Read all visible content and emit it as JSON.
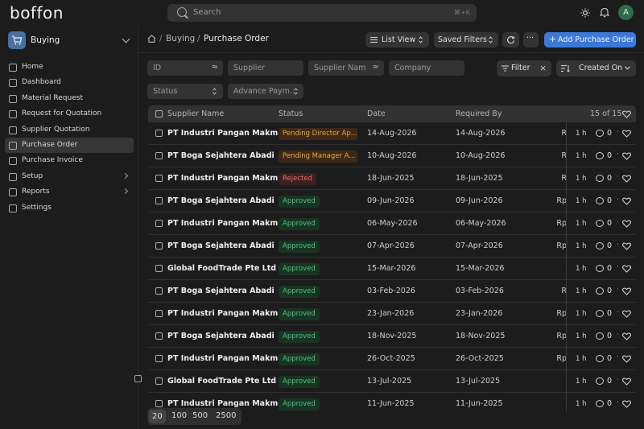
{
  "app": {
    "logo": "boffon",
    "module": "Buying"
  },
  "search": {
    "placeholder": "Search",
    "shortcut": "⌘+K"
  },
  "user": {
    "avatar_initial": "A"
  },
  "sidebar": {
    "items": [
      {
        "label": "Home",
        "icon": "home-icon"
      },
      {
        "label": "Dashboard",
        "icon": "dashboard-icon"
      },
      {
        "label": "Material Request",
        "icon": "document-icon"
      },
      {
        "label": "Request for Quotation",
        "icon": "document-icon"
      },
      {
        "label": "Supplier Quotation",
        "icon": "document-icon"
      },
      {
        "label": "Purchase Order",
        "icon": "document-icon",
        "active": true
      },
      {
        "label": "Purchase Invoice",
        "icon": "document-icon"
      },
      {
        "label": "Setup",
        "icon": "gear-icon",
        "expandable": true
      },
      {
        "label": "Reports",
        "icon": "grid-icon",
        "expandable": true
      },
      {
        "label": "Settings",
        "icon": "gear-icon"
      }
    ]
  },
  "header": {
    "breadcrumb": [
      "Buying",
      "Purchase Order"
    ],
    "list_view_label": "List View",
    "saved_filters_label": "Saved Filters",
    "add_label": "Add Purchase Order",
    "more_label": "···"
  },
  "filters": {
    "id_placeholder": "ID",
    "id_operator": "≈",
    "supplier_placeholder": "Supplier",
    "supplier_name_placeholder": "Supplier Nam",
    "supplier_name_operator": "≈",
    "company_placeholder": "Company",
    "status_placeholder": "Status",
    "advance_payment_placeholder": "Advance Paym...",
    "filter_label": "Filter",
    "sort_label": "Created On"
  },
  "table": {
    "columns": [
      "Supplier Name",
      "Status",
      "Date",
      "Required By"
    ],
    "count": "15 of 15",
    "rows": [
      {
        "supplier": "PT Industri Pangan Makmur",
        "status": "Pending Director Ap...",
        "status_type": "pending",
        "date": "14-Aug-2026",
        "required_by": "14-Aug-2026",
        "amount": "R",
        "modified": "1 h",
        "comments": "0"
      },
      {
        "supplier": "PT Boga Sejahtera Abadi",
        "status": "Pending Manager A...",
        "status_type": "pending",
        "date": "10-Aug-2026",
        "required_by": "10-Aug-2026",
        "amount": "R",
        "modified": "1 h",
        "comments": "0"
      },
      {
        "supplier": "PT Industri Pangan Makmur",
        "status": "Rejected",
        "status_type": "rejected",
        "date": "18-Jun-2025",
        "required_by": "18-Jun-2025",
        "amount": "R",
        "modified": "1 h",
        "comments": "0"
      },
      {
        "supplier": "PT Boga Sejahtera Abadi",
        "status": "Approved",
        "status_type": "approved",
        "date": "09-Jun-2026",
        "required_by": "09-Jun-2026",
        "amount": "Rp",
        "modified": "1 h",
        "comments": "0"
      },
      {
        "supplier": "PT Industri Pangan Makmur",
        "status": "Approved",
        "status_type": "approved",
        "date": "06-May-2026",
        "required_by": "06-May-2026",
        "amount": "Rp",
        "modified": "1 h",
        "comments": "0"
      },
      {
        "supplier": "PT Boga Sejahtera Abadi",
        "status": "Approved",
        "status_type": "approved",
        "date": "07-Apr-2026",
        "required_by": "07-Apr-2026",
        "amount": "Rp",
        "modified": "1 h",
        "comments": "0"
      },
      {
        "supplier": "Global FoodTrade Pte Ltd",
        "status": "Approved",
        "status_type": "approved",
        "date": "15-Mar-2026",
        "required_by": "15-Mar-2026",
        "amount": "",
        "modified": "1 h",
        "comments": "0"
      },
      {
        "supplier": "PT Boga Sejahtera Abadi",
        "status": "Approved",
        "status_type": "approved",
        "date": "03-Feb-2026",
        "required_by": "03-Feb-2026",
        "amount": "R",
        "modified": "1 h",
        "comments": "0"
      },
      {
        "supplier": "PT Industri Pangan Makmur",
        "status": "Approved",
        "status_type": "approved",
        "date": "23-Jan-2026",
        "required_by": "23-Jan-2026",
        "amount": "Rp",
        "modified": "1 h",
        "comments": "0"
      },
      {
        "supplier": "PT Boga Sejahtera Abadi",
        "status": "Approved",
        "status_type": "approved",
        "date": "18-Nov-2025",
        "required_by": "18-Nov-2025",
        "amount": "Rp",
        "modified": "1 h",
        "comments": "0"
      },
      {
        "supplier": "PT Industri Pangan Makmur",
        "status": "Approved",
        "status_type": "approved",
        "date": "26-Oct-2025",
        "required_by": "26-Oct-2025",
        "amount": "Rp",
        "modified": "1 h",
        "comments": "0"
      },
      {
        "supplier": "Global FoodTrade Pte Ltd",
        "status": "Approved",
        "status_type": "approved",
        "date": "13-Jul-2025",
        "required_by": "13-Jul-2025",
        "amount": "",
        "modified": "1 h",
        "comments": "0"
      },
      {
        "supplier": "PT Industri Pangan Makmur",
        "status": "Approved",
        "status_type": "approved",
        "date": "11-Jun-2025",
        "required_by": "11-Jun-2025",
        "amount": "",
        "modified": "1 h",
        "comments": "0"
      }
    ]
  },
  "paging": {
    "sizes": [
      "20",
      "100",
      "500",
      "2500"
    ],
    "active": "20"
  },
  "colors": {
    "primary": "#3c78d8",
    "pending": "#f0a23d",
    "rejected": "#f06a6a",
    "approved": "#4fc27d"
  }
}
